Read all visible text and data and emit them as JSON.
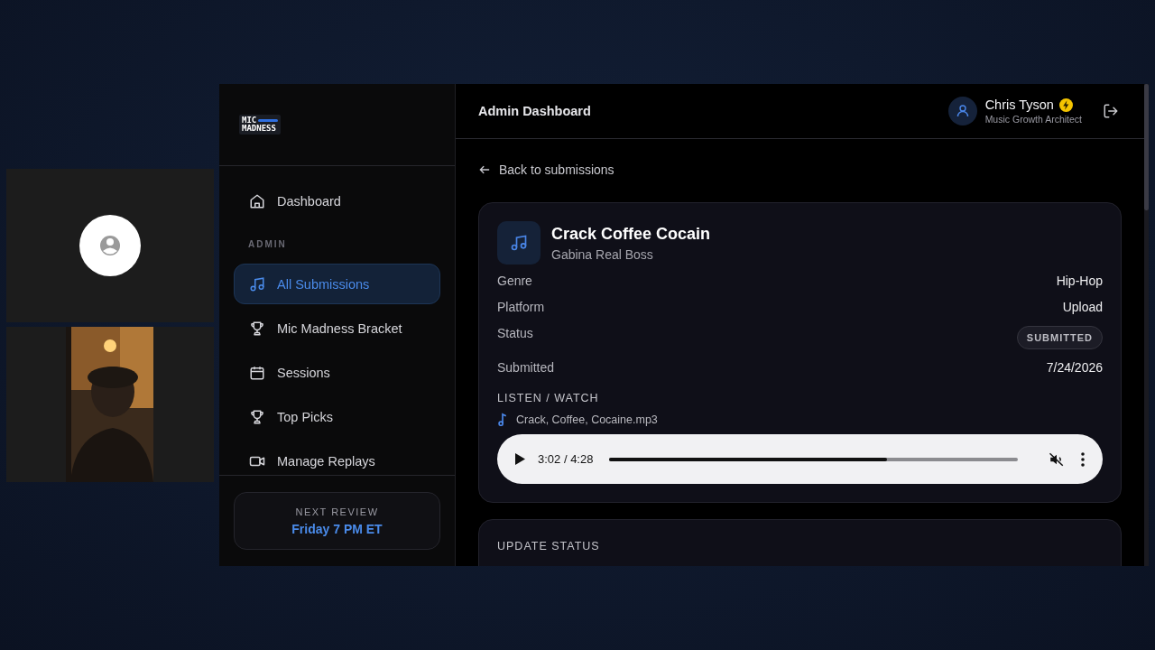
{
  "participants": [
    {
      "kind": "avatar"
    },
    {
      "kind": "picture"
    }
  ],
  "logo": {
    "line_1": "MIC",
    "line_2": "MADNESS"
  },
  "sidebar": {
    "top_items": [
      {
        "label": "Dashboard",
        "selected": false
      }
    ],
    "section": {
      "heading": "ADMIN",
      "items": [
        {
          "label": "All Submissions",
          "selected": true
        },
        {
          "label": "Mic Madness Bracket",
          "selected": false
        },
        {
          "label": "Sessions",
          "selected": false
        },
        {
          "label": "Top Picks",
          "selected": false
        },
        {
          "label": "Manage Replays",
          "selected": false
        }
      ]
    },
    "next_review": {
      "label": "NEXT REVIEW",
      "value": "Friday 7 PM ET"
    }
  },
  "header": {
    "title": "Admin Dashboard",
    "user": {
      "name": "Chris Tyson",
      "role": "Music Growth Architect",
      "verified": true
    }
  },
  "back_link": "Back to submissions",
  "submission": {
    "title": "Crack Coffee Cocain",
    "artist": "Gabina Real Boss",
    "details": [
      {
        "kind": "text",
        "label": "Genre",
        "value": "Hip-Hop"
      },
      {
        "kind": "text",
        "label": "Platform",
        "value": "Upload"
      },
      {
        "kind": "badge",
        "label": "Status",
        "value": "SUBMITTED"
      },
      {
        "kind": "text",
        "label": "Submitted",
        "value": "7/24/2026"
      }
    ],
    "media_heading": "LISTEN / WATCH",
    "file_name": "Crack, Coffee, Cocaine.mp3",
    "player": {
      "time": "3:02 / 4:28",
      "level": 0.68,
      "muted": true
    }
  },
  "update_status": {
    "heading": "UPDATE STATUS"
  }
}
